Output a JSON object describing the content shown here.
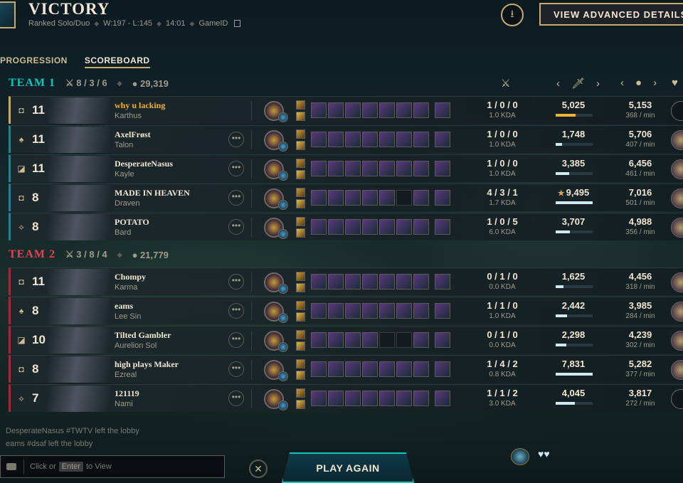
{
  "header": {
    "title": "VICTORY",
    "queue": "Ranked Solo/Duo",
    "record": "W:197 - L:145",
    "duration": "14:01",
    "game_id_label": "GameID",
    "advanced_button": "VIEW ADVANCED DETAILS"
  },
  "tabs": [
    {
      "label": "PROGRESSION",
      "active": false
    },
    {
      "label": "SCOREBOARD",
      "active": true
    }
  ],
  "teams": [
    {
      "name": "TEAM 1",
      "kda": "8 / 3 / 6",
      "gold": "29,319",
      "players": [
        {
          "level": "11",
          "name": "why u lacking",
          "champion": "Karthus",
          "kda": "1 / 0 / 0",
          "kda_ratio": "1.0 KDA",
          "damage": "5,025",
          "damage_frac": 0.53,
          "gold": "5,153",
          "gpm": "368 / min",
          "items": 8,
          "me": true
        },
        {
          "level": "11",
          "name": "AxelFrøst",
          "champion": "Talon",
          "kda": "1 / 0 / 0",
          "kda_ratio": "1.0 KDA",
          "damage": "1,748",
          "damage_frac": 0.18,
          "gold": "5,706",
          "gpm": "407 / min",
          "items": 7
        },
        {
          "level": "11",
          "name": "DesperateNasus",
          "champion": "Kayle",
          "kda": "1 / 0 / 0",
          "kda_ratio": "1.0 KDA",
          "damage": "3,385",
          "damage_frac": 0.36,
          "gold": "6,456",
          "gpm": "461 / min",
          "items": 7
        },
        {
          "level": "8",
          "name": "MADE IN HEAVEN",
          "champion": "Draven",
          "kda": "4 / 3 / 1",
          "kda_ratio": "1.7 KDA",
          "damage": "9,495",
          "damage_frac": 1.0,
          "gold": "7,016",
          "gpm": "501 / min",
          "items": 5,
          "star": true
        },
        {
          "level": "8",
          "name": "POTATO",
          "champion": "Bard",
          "kda": "1 / 0 / 5",
          "kda_ratio": "6.0 KDA",
          "damage": "3,707",
          "damage_frac": 0.39,
          "gold": "4,988",
          "gpm": "356 / min",
          "items": 9
        }
      ]
    },
    {
      "name": "TEAM 2",
      "kda": "3 / 8 / 4",
      "gold": "21,779",
      "players": [
        {
          "level": "11",
          "name": "Chompy",
          "champion": "Karma",
          "kda": "0 / 1 / 0",
          "kda_ratio": "0.0 KDA",
          "damage": "1,625",
          "damage_frac": 0.21,
          "gold": "4,456",
          "gpm": "318 / min",
          "items": 6
        },
        {
          "level": "8",
          "name": "eams",
          "champion": "Lee Sin",
          "kda": "1 / 1 / 0",
          "kda_ratio": "1.0 KDA",
          "damage": "2,442",
          "damage_frac": 0.31,
          "gold": "3,985",
          "gpm": "284 / min",
          "items": 7
        },
        {
          "level": "10",
          "name": "Tilted Gambler",
          "champion": "Aurelion Sol",
          "kda": "0 / 1 / 0",
          "kda_ratio": "0.0 KDA",
          "damage": "2,298",
          "damage_frac": 0.29,
          "gold": "4,239",
          "gpm": "302 / min",
          "items": 4
        },
        {
          "level": "8",
          "name": "high plays Maker",
          "champion": "Ezreal",
          "kda": "1 / 4 / 2",
          "kda_ratio": "0.8 KDA",
          "damage": "7,831",
          "damage_frac": 1.0,
          "gold": "5,282",
          "gpm": "377 / min",
          "items": 8
        },
        {
          "level": "7",
          "name": "121119",
          "champion": "Nami",
          "kda": "1 / 1 / 2",
          "kda_ratio": "3.0 KDA",
          "damage": "4,045",
          "damage_frac": 0.52,
          "gold": "3,817",
          "gpm": "272 / min",
          "items": 6
        }
      ]
    }
  ],
  "chat": {
    "log": [
      "DesperateNasus #TWTV left the lobby",
      "eams #dsaf left the lobby"
    ],
    "placeholder_prefix": "Click or",
    "key": "Enter",
    "placeholder_suffix": "to View"
  },
  "footer": {
    "play_again": "PLAY AGAIN"
  },
  "colors": {
    "gold": "#c8aa6e",
    "team1": "#0ac8b9",
    "team2": "#e84057",
    "highlight": "#f0b232"
  }
}
